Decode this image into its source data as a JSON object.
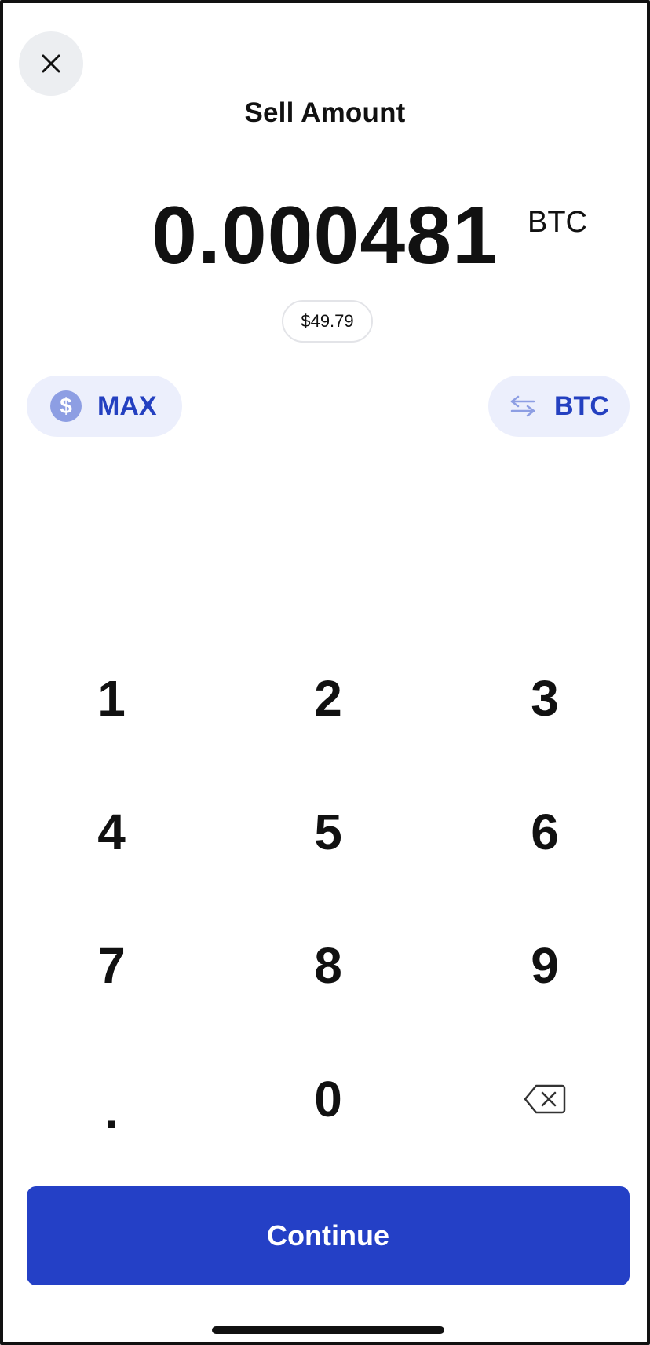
{
  "header": {
    "title": "Sell Amount",
    "close_icon": "close-icon"
  },
  "amount": {
    "value": "0.000481",
    "unit": "BTC",
    "fiat_equivalent": "$49.79"
  },
  "chips": {
    "max_label": "MAX",
    "max_icon_glyph": "$",
    "currency_toggle_label": "BTC",
    "currency_toggle_icon": "swap-arrows-icon"
  },
  "keypad": {
    "keys": [
      "1",
      "2",
      "3",
      "4",
      "5",
      "6",
      "7",
      "8",
      "9",
      ".",
      "0"
    ],
    "backspace_icon": "backspace-icon"
  },
  "footer": {
    "continue_label": "Continue"
  },
  "colors": {
    "accent": "#2440c6",
    "chip_background": "#eceffc",
    "chip_text": "#2440c0",
    "close_background": "#eceef1"
  }
}
